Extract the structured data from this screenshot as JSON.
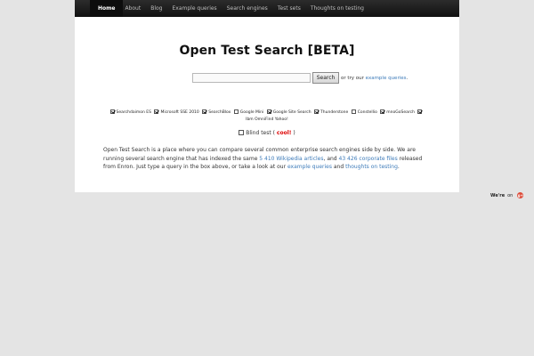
{
  "nav": {
    "items": [
      "Home",
      "About",
      "Blog",
      "Example queries",
      "Search engines",
      "Test sets",
      "Thoughts on testing"
    ],
    "active": "Home"
  },
  "page": {
    "title": "Open Test Search [BETA]"
  },
  "search": {
    "value": "",
    "placeholder": "",
    "button_label": "Search",
    "try_prefix": "or try our ",
    "try_link": "example queries",
    "try_suffix": "."
  },
  "engines": [
    {
      "label": "Searchdaimon ES",
      "checked": true
    },
    {
      "label": "Microsoft SSE 2010",
      "checked": true
    },
    {
      "label": "SearchBlox",
      "checked": false
    },
    {
      "label": "Google Mini",
      "checked": true
    },
    {
      "label": "Google Site Search",
      "checked": true
    },
    {
      "label": "Thunderstone",
      "checked": false
    },
    {
      "label": "Constellio",
      "checked": true
    },
    {
      "label": "mnoGoSearch",
      "checked": true
    },
    {
      "label": "Ibm OmniFind Yahoo!",
      "checked": null
    }
  ],
  "blind_test": {
    "label": "Blind test",
    "paren_open": "(",
    "cool": "cool!",
    "paren_close": ")",
    "checked": false
  },
  "description": {
    "part1": "Open Test Search is a place where you can compare several common enterprise search engines side by side. We are running several search engine that has indexed the same ",
    "link1": "5 410 Wikipedia articles",
    "part2": ", and ",
    "link2": "43 426 corporate files",
    "part3": " released from Enron. Just type a query in the box above, or take a look at our ",
    "link3": "example queries",
    "part4": " and ",
    "link4": "thoughts on testing",
    "part5": "."
  },
  "social": {
    "label1": "We're",
    "label2": "on",
    "icon_text": "g+"
  },
  "colors": {
    "link": "#3d7bb9",
    "cool": "#dd0000",
    "nav_bg": "#1a1a1a",
    "page_bg": "#e4e4e4",
    "gplus": "#dd4b39"
  }
}
